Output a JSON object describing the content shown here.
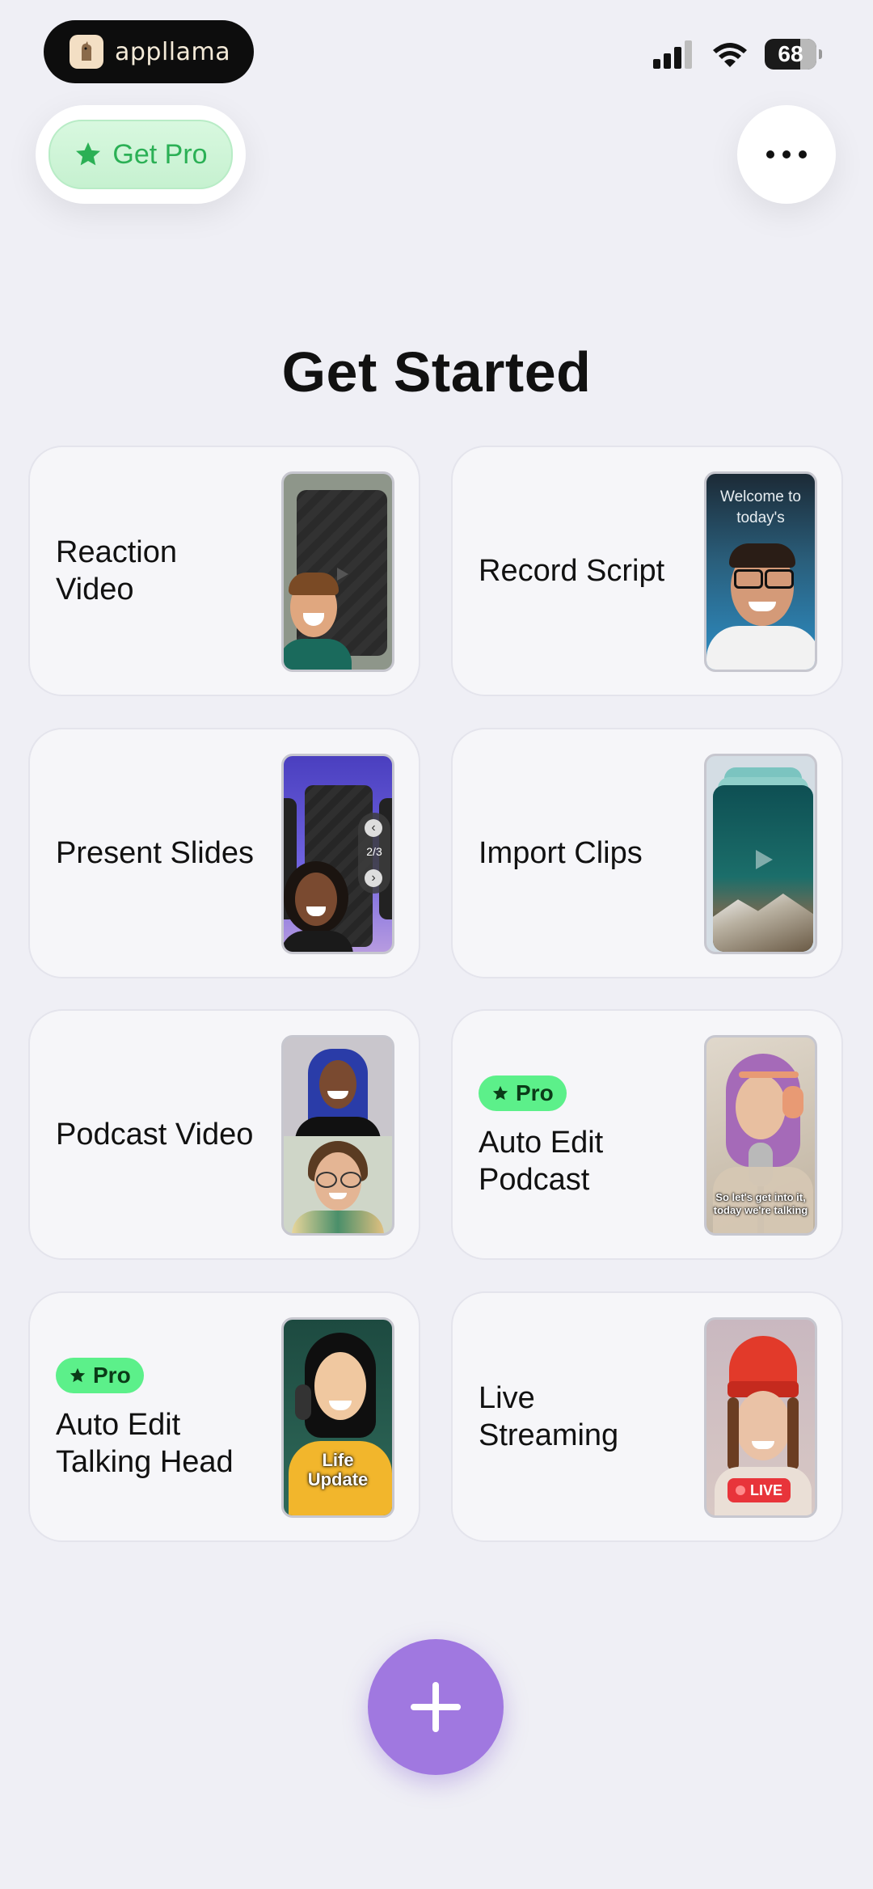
{
  "status_bar": {
    "brand": "appllama",
    "battery": "68"
  },
  "header": {
    "get_pro_label": "Get Pro"
  },
  "title": "Get Started",
  "cards": [
    {
      "label": "Reaction Video"
    },
    {
      "label": "Record Script",
      "thumb_text": "Welcome to today's"
    },
    {
      "label": "Present Slides",
      "thumb_text": "2/3"
    },
    {
      "label": "Import Clips"
    },
    {
      "label": "Podcast Video"
    },
    {
      "label": "Auto Edit Podcast",
      "badge": "Pro",
      "thumb_text": "So let's get into it, today we're talking"
    },
    {
      "label": "Auto Edit Talking Head",
      "badge": "Pro",
      "thumb_text": "Life Update"
    },
    {
      "label": "Live Streaming",
      "thumb_text": "LIVE"
    }
  ],
  "colors": {
    "accent_green": "#5cf08a",
    "fab_purple": "#a078e0",
    "live_red": "#e8343a"
  }
}
